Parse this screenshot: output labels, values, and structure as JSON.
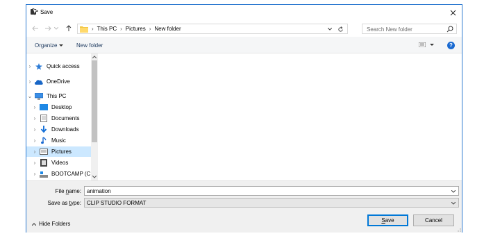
{
  "window": {
    "title": "Save",
    "close_icon": "close-icon"
  },
  "address": {
    "crumbs": [
      "This PC",
      "Pictures",
      "New folder"
    ],
    "search_placeholder": "Search New folder"
  },
  "toolbar": {
    "organize": "Organize",
    "new_folder": "New folder",
    "help": "?"
  },
  "sidebar": {
    "items": [
      {
        "label": "Quick access",
        "icon": "star-icon",
        "level": 0,
        "selected": false
      },
      {
        "label": "OneDrive",
        "icon": "cloud-icon",
        "level": 0,
        "selected": false
      },
      {
        "label": "This PC",
        "icon": "computer-icon",
        "level": 0,
        "selected": false
      },
      {
        "label": "Desktop",
        "icon": "desktop-icon",
        "level": 1,
        "selected": false
      },
      {
        "label": "Documents",
        "icon": "documents-icon",
        "level": 1,
        "selected": false
      },
      {
        "label": "Downloads",
        "icon": "downloads-icon",
        "level": 1,
        "selected": false
      },
      {
        "label": "Music",
        "icon": "music-icon",
        "level": 1,
        "selected": false
      },
      {
        "label": "Pictures",
        "icon": "pictures-icon",
        "level": 1,
        "selected": true
      },
      {
        "label": "Videos",
        "icon": "videos-icon",
        "level": 1,
        "selected": false
      },
      {
        "label": "BOOTCAMP (C:)",
        "icon": "drive-icon",
        "level": 1,
        "selected": false
      }
    ]
  },
  "form": {
    "file_name_label_pre": "File ",
    "file_name_label_u": "n",
    "file_name_label_post": "ame:",
    "file_name_value": "animation",
    "save_type_label_pre": "Save as ",
    "save_type_label_u": "t",
    "save_type_label_post": "ype:",
    "save_type_value": "CLIP STUDIO FORMAT"
  },
  "footer": {
    "hide_folders": "Hide Folders",
    "save_u": "S",
    "save_rest": "ave",
    "cancel": "Cancel"
  },
  "colors": {
    "accent": "#0078d7",
    "selected_bg": "#cce8ff",
    "border": "#2b79d0"
  }
}
